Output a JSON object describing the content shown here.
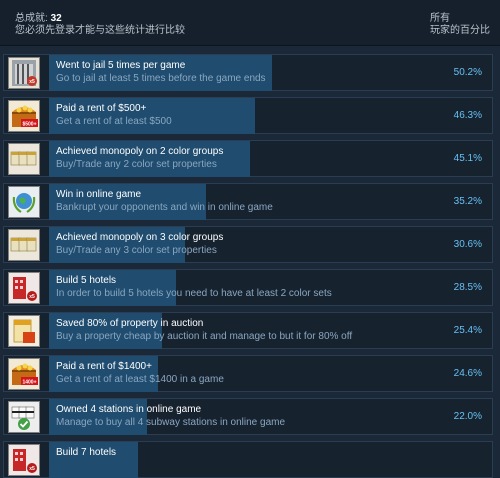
{
  "header": {
    "achievements_label": "总成就:",
    "achievements_count": "32",
    "login_notice": "您必须先登录才能与这些统计进行比较",
    "all_players_line1": "所有",
    "all_players_line2": "玩家的百分比"
  },
  "achievements": [
    {
      "title": "Went to jail 5 times per game",
      "description": "Go to jail at least 5 times before the game ends",
      "percent_text": "50.2%",
      "percent": 50.2,
      "icon": "jail-icon"
    },
    {
      "title": "Paid a rent of $500+",
      "description": "Get a rent of at least $500",
      "percent_text": "46.3%",
      "percent": 46.3,
      "icon": "treasure-chest-500-icon"
    },
    {
      "title": "Achieved monopoly on 2 color groups",
      "description": "Buy/Trade any 2 color set properties",
      "percent_text": "45.1%",
      "percent": 45.1,
      "icon": "property-cards-icon"
    },
    {
      "title": "Win in online game",
      "description": "Bankrupt your opponents and win in online game",
      "percent_text": "35.2%",
      "percent": 35.2,
      "icon": "globe-laurel-icon"
    },
    {
      "title": "Achieved monopoly on 3 color groups",
      "description": "Buy/Trade any 3 color set properties",
      "percent_text": "30.6%",
      "percent": 30.6,
      "icon": "property-cards-icon"
    },
    {
      "title": "Build 5 hotels",
      "description": "In order to build 5 hotels you need to have at least 2 color sets",
      "percent_text": "28.5%",
      "percent": 28.5,
      "icon": "hotel-icon"
    },
    {
      "title": "Saved 80% of property in auction",
      "description": "Buy a property cheap by auction it and manage to but it for 80% off",
      "percent_text": "25.4%",
      "percent": 25.4,
      "icon": "auction-tag-icon"
    },
    {
      "title": "Paid a rent of $1400+",
      "description": "Get a rent of at least $1400 in a game",
      "percent_text": "24.6%",
      "percent": 24.6,
      "icon": "treasure-chest-1400-icon"
    },
    {
      "title": "Owned 4 stations in online game",
      "description": "Manage to buy all 4 subway stations in online game",
      "percent_text": "22.0%",
      "percent": 22.0,
      "icon": "stations-check-icon"
    },
    {
      "title": "Build 7 hotels",
      "description": "",
      "percent_text": "",
      "percent": 20.0,
      "icon": "hotel-icon"
    }
  ],
  "icon_badges": {
    "jail": "x5",
    "chest_500": "$500+",
    "hotel": "x5",
    "chest_1400": "1400+"
  },
  "colors": {
    "background": "#1b2838",
    "bar": "#1f4c6f",
    "percent_text": "#66c0f4"
  }
}
